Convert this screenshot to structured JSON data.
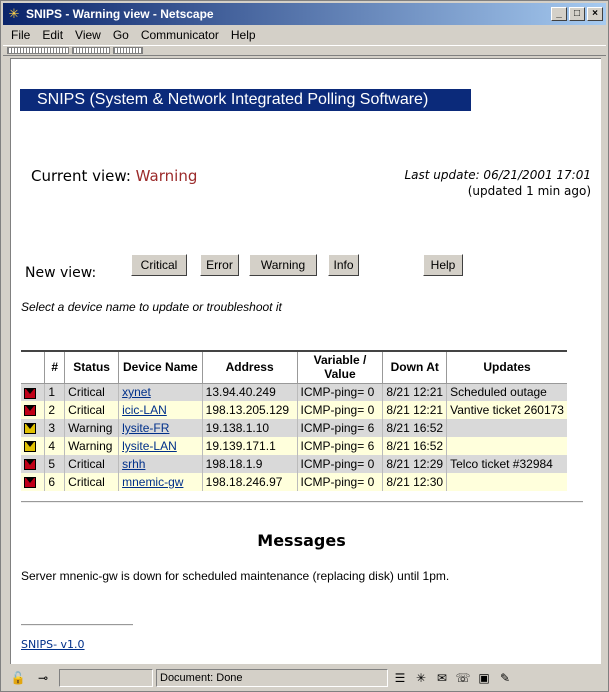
{
  "window": {
    "title": "SNIPS - Warning view - Netscape"
  },
  "menu": [
    "File",
    "Edit",
    "View",
    "Go",
    "Communicator",
    "Help"
  ],
  "banner": "SNIPS (System & Network Integrated Polling Software)",
  "current_view": {
    "label": "Current view:",
    "value": "Warning"
  },
  "last_update": {
    "line1": "Last update: 06/21/2001 17:01",
    "line2": "(updated 1 min ago)"
  },
  "new_view": {
    "label": "New view:",
    "buttons": [
      "Critical",
      "Error",
      "Warning",
      "Info"
    ],
    "help": "Help"
  },
  "hint": "Select a device name to update or troubleshoot it",
  "table": {
    "headers": [
      "",
      "#",
      "Status",
      "Device Name",
      "Address",
      "Variable / Value",
      "Down At",
      "Updates"
    ],
    "rows": [
      {
        "flag": "red",
        "num": "1",
        "status": "Critical",
        "device": "xynet",
        "address": "13.94.40.249",
        "variable": "ICMP-ping= 0",
        "down_at": "8/21 12:21",
        "updates": "Scheduled outage"
      },
      {
        "flag": "red",
        "num": "2",
        "status": "Critical",
        "device": "icic-LAN",
        "address": "198.13.205.129",
        "variable": "ICMP-ping= 0",
        "down_at": "8/21 12:21",
        "updates": "Vantive ticket 260173"
      },
      {
        "flag": "yellow",
        "num": "3",
        "status": "Warning",
        "device": "lysite-FR",
        "address": "19.138.1.10",
        "variable": "ICMP-ping= 6",
        "down_at": "8/21 16:52",
        "updates": ""
      },
      {
        "flag": "yellow",
        "num": "4",
        "status": "Warning",
        "device": "lysite-LAN",
        "address": "19.139.171.1",
        "variable": "ICMP-ping= 6",
        "down_at": "8/21 16:52",
        "updates": ""
      },
      {
        "flag": "red",
        "num": "5",
        "status": "Critical",
        "device": "srhh",
        "address": "198.18.1.9",
        "variable": "ICMP-ping= 0",
        "down_at": "8/21 12:29",
        "updates": "Telco ticket #32984"
      },
      {
        "flag": "red",
        "num": "6",
        "status": "Critical",
        "device": "mnemic-gw",
        "address": "198.18.246.97",
        "variable": "ICMP-ping= 0",
        "down_at": "8/21 12:30",
        "updates": ""
      }
    ]
  },
  "messages": {
    "title": "Messages",
    "text": "Server mnenic-gw is down for scheduled maintenance (replacing disk) until 1pm."
  },
  "footer_link": "SNIPS- v1.0",
  "status_bar": {
    "text": "Document: Done"
  },
  "colors": {
    "banner_bg": "#0b2a7a",
    "warning_text": "#9b2a2a",
    "critical_flag": "#c00018",
    "warning_flag": "#e0c000",
    "row_grey": "#d9d9d9",
    "row_yellow": "#ffffdc"
  }
}
